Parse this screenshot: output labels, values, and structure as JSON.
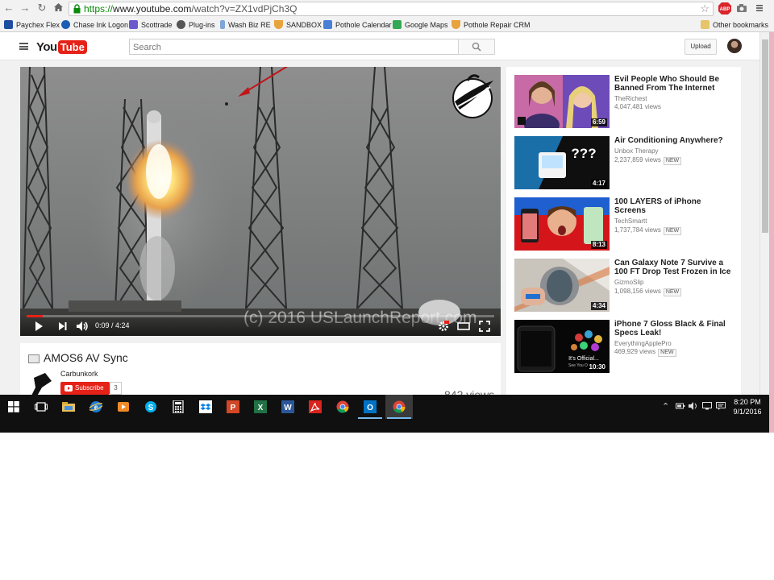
{
  "browser": {
    "url_protocol": "https://",
    "url_domain": "www.youtube.com",
    "url_path": "/watch?v=ZX1vdPjCh3Q",
    "bookmarks": [
      {
        "label": "Paychex Flex",
        "color": "#1d4ea0"
      },
      {
        "label": "Chase Ink Logon",
        "color": "#1a5fb4"
      },
      {
        "label": "Scottrade",
        "color": "#6a5acd"
      },
      {
        "label": "Plug-ins",
        "color": "#555555"
      },
      {
        "label": "Wash Biz RE",
        "color": "#7ea6d9"
      },
      {
        "label": "SANDBOX",
        "color": "#e8a33d"
      },
      {
        "label": "Pothole Calendar",
        "color": "#4a7fd6"
      },
      {
        "label": "Google Maps",
        "color": "#34a853"
      },
      {
        "label": "Pothole Repair CRM",
        "color": "#e8a33d"
      }
    ],
    "other_bookmarks": "Other bookmarks",
    "extension_badge": "ABP"
  },
  "youtube": {
    "logo_you": "You",
    "logo_tube": "Tube",
    "search_placeholder": "Search",
    "upload_label": "Upload"
  },
  "player": {
    "time": "0:09 / 4:24",
    "progress_fraction": 0.034,
    "watermark": "(c) 2016 USLaunchReport.com"
  },
  "video": {
    "title": "AMOS6 AV Sync",
    "channel": "Carbunkork",
    "subscribe_label": "Subscribe",
    "subscriber_count": "3",
    "views": "842 views"
  },
  "recommendations": [
    {
      "title": "Evil People Who Should Be Banned From The Internet",
      "channel": "TheRichest",
      "views": "4,047,481 views",
      "duration": "6:59",
      "new": ""
    },
    {
      "title": "Air Conditioning Anywhere?",
      "channel": "Unbox Therapy",
      "views": "2,237,859 views",
      "duration": "4:17",
      "new": "NEW"
    },
    {
      "title": "100 LAYERS of iPhone Screens",
      "channel": "TechSmartt",
      "views": "1,737,784 views",
      "duration": "8:13",
      "new": "NEW"
    },
    {
      "title": "Can Galaxy Note 7 Survive a 100 FT Drop Test Frozen in Ice",
      "channel": "GizmoSlip",
      "views": "1,098,156 views",
      "duration": "4:34",
      "new": "NEW"
    },
    {
      "title": "iPhone 7 Gloss Black & Final Specs Leak!",
      "channel": "EverythingApplePro",
      "views": "469,929 views",
      "duration": "10:30",
      "new": "NEW"
    }
  ],
  "thumbnail_text": {
    "aircon": "???",
    "iphone": "It's Official...",
    "iphone_sub": "See You On Th..."
  },
  "taskbar": {
    "clock_time": "8:20 PM",
    "clock_date": "9/1/2016",
    "apps": [
      "start-icon",
      "task-view-icon",
      "file-explorer-icon",
      "ie-icon",
      "media-player-icon",
      "skype-icon",
      "calculator-icon",
      "dropbox-icon",
      "powerpoint-icon",
      "excel-icon",
      "word-icon",
      "acrobat-icon",
      "chrome-icon",
      "outlook-icon",
      "chrome-active-icon"
    ]
  },
  "colors": {
    "youtube_red": "#e62117",
    "taskbar": "#101010",
    "page_bg": "#f1f1f1"
  }
}
